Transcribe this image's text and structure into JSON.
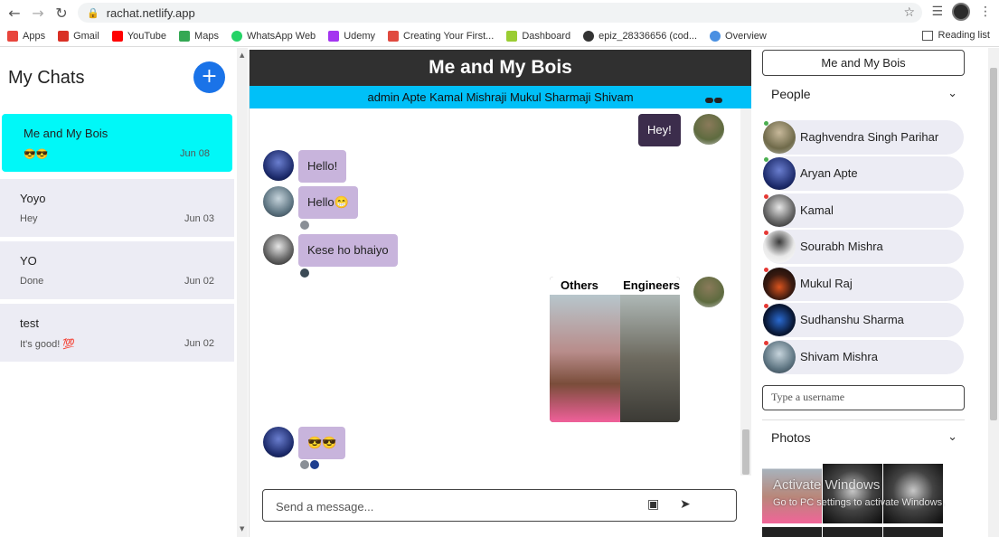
{
  "browser": {
    "url": "rachat.netlify.app",
    "bookmarks": [
      {
        "label": "Apps",
        "color": "#e8453c"
      },
      {
        "label": "Gmail",
        "color": "#d93025"
      },
      {
        "label": "YouTube",
        "color": "#ff0000"
      },
      {
        "label": "Maps",
        "color": "#34a853"
      },
      {
        "label": "WhatsApp Web",
        "color": "#25d366"
      },
      {
        "label": "Udemy",
        "color": "#a435f0"
      },
      {
        "label": "Creating Your First...",
        "color": "#e04a3f"
      },
      {
        "label": "Dashboard",
        "color": "#9acd32"
      },
      {
        "label": "epiz_28336656 (cod...",
        "color": "#333333"
      },
      {
        "label": "Overview",
        "color": "#4a90e2"
      }
    ],
    "reading_list": "Reading list"
  },
  "sidebar": {
    "title": "My Chats",
    "add_label": "+",
    "chats": [
      {
        "name": "Me and My Bois",
        "preview": "😎😎",
        "date": "Jun 08"
      },
      {
        "name": "Yoyo",
        "preview": "Hey",
        "date": "Jun 03"
      },
      {
        "name": "YO",
        "preview": "Done",
        "date": "Jun 02"
      },
      {
        "name": "test",
        "preview": "It's good! 💯",
        "date": "Jun 02"
      }
    ]
  },
  "conversation": {
    "title": "Me and My Bois",
    "members": "admin Apte Kamal Mishraji Mukul Sharmaji Shivam",
    "messages": [
      {
        "text": "Hey!"
      },
      {
        "text": "Hello!"
      },
      {
        "text": "Hello😁"
      },
      {
        "text": "Kese ho bhaiyo"
      },
      {
        "text": "😎😎"
      }
    ],
    "image_message": {
      "left_label": "Others",
      "right_label": "Engineers"
    },
    "composer_placeholder": "Send a message..."
  },
  "details": {
    "chat_title": "Me and My Bois",
    "people_heading": "People",
    "people": [
      {
        "name": "Raghvendra Singh Parihar",
        "online": true
      },
      {
        "name": "Aryan Apte",
        "online": true
      },
      {
        "name": "Kamal",
        "online": false
      },
      {
        "name": "Sourabh Mishra",
        "online": false
      },
      {
        "name": "Mukul Raj",
        "online": false
      },
      {
        "name": "Sudhanshu Sharma",
        "online": false
      },
      {
        "name": "Shivam Mishra",
        "online": false
      }
    ],
    "username_placeholder": "Type a username",
    "photos_heading": "Photos"
  },
  "os_watermark": {
    "line1": "Activate Windows",
    "line2": "Go to PC settings to activate Windows."
  },
  "colors": {
    "active_chat": "#00f8f8",
    "header_bg": "#303030",
    "members_bar": "#00c0f8",
    "incoming_bubble": "#c8b4dc",
    "outgoing_bubble": "#3c2d4c",
    "add_button": "#1a73e8"
  }
}
